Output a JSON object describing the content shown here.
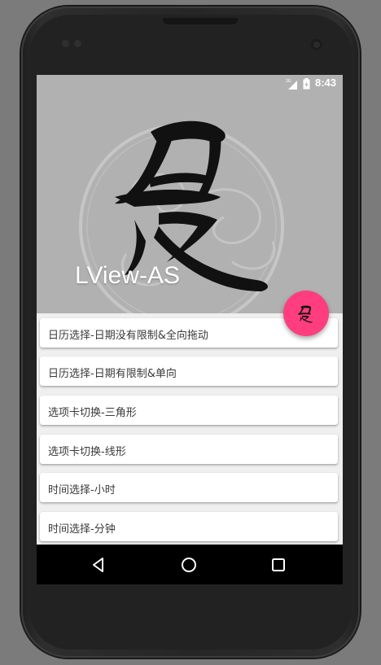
{
  "status_bar": {
    "time": "8:43",
    "network": "3G",
    "signal_icon": "signal-icon",
    "battery_icon": "battery-icon"
  },
  "header": {
    "title": "LView-AS",
    "background_color": "#b1b1b1",
    "logo": "brush-calligraphy-logo"
  },
  "fab": {
    "icon": "calligraphy-logo-icon",
    "color": "#ff3d7f"
  },
  "list": {
    "items": [
      {
        "label": "日历选择-日期没有限制&全向拖动"
      },
      {
        "label": "日历选择-日期有限制&单向"
      },
      {
        "label": "选项卡切换-三角形"
      },
      {
        "label": "选项卡切换-线形"
      },
      {
        "label": "时间选择-小时"
      },
      {
        "label": "时间选择-分钟"
      }
    ]
  },
  "nav_bar": {
    "back_icon": "back-triangle-icon",
    "home_icon": "home-circle-icon",
    "recents_icon": "recents-square-icon"
  }
}
